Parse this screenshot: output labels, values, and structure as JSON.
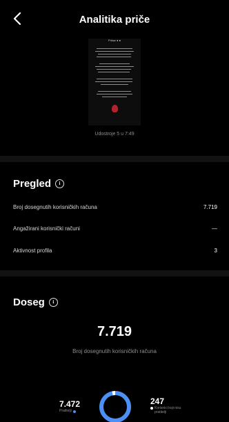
{
  "header": {
    "title": "Analitika priče",
    "back_icon": "chevron-left-icon"
  },
  "preview": {
    "caption": "Prikaz ● ●"
  },
  "views_text": "Udostroje 5 u 7:49",
  "overview": {
    "title": "Pregled",
    "rows": [
      {
        "label": "Broj dosegnutih korisničkih računa",
        "value": "7.719"
      },
      {
        "label": "Angažirani korisnički računi",
        "value": "—"
      },
      {
        "label": "Aktivnost profila",
        "value": "3"
      }
    ]
  },
  "reach": {
    "title": "Doseg",
    "total": "7.719",
    "caption": "Broj dosegnutih korisničkih računa",
    "followers": {
      "value": "7.472",
      "label": "Pratitelji"
    },
    "non_followers": {
      "value": "247",
      "label": "Korisnici koji nisu pratitelji"
    },
    "followers_share": 0.968,
    "colors": {
      "followers": "#4c8ff5",
      "non_followers": "#ffffff"
    }
  }
}
